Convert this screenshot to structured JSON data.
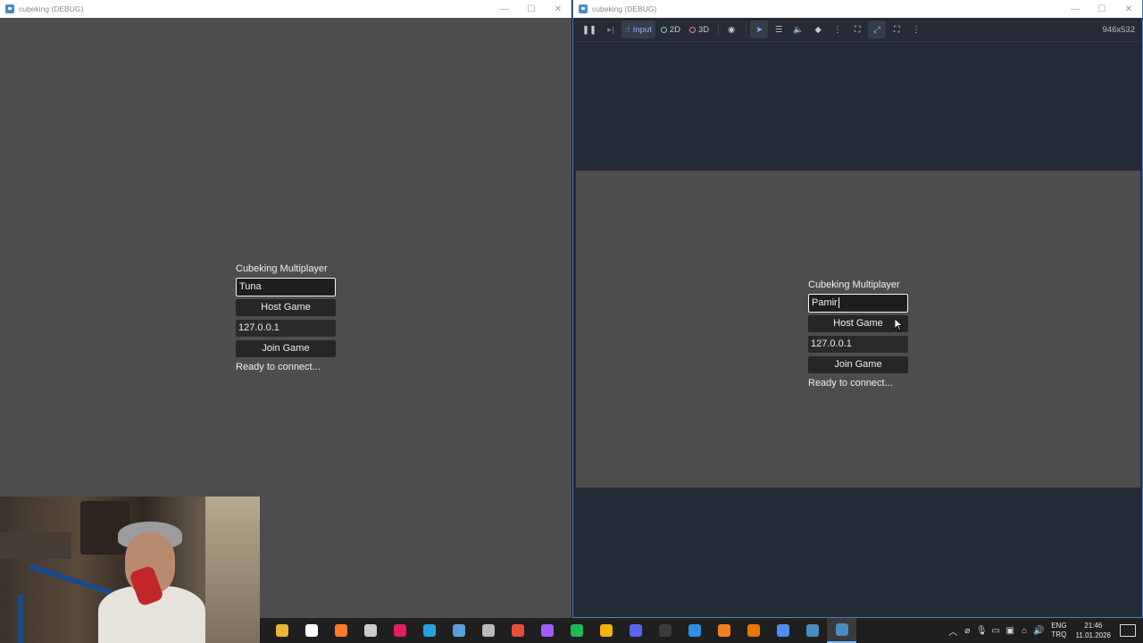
{
  "left_window": {
    "title": "cubeking (DEBUG)",
    "controls": {
      "minimize": "—",
      "maximize": "☐",
      "close": "✕"
    },
    "menu": {
      "title": "Cubeking Multiplayer",
      "name_value": "Tuna",
      "host_label": "Host Game",
      "ip_value": "127.0.0.1",
      "join_label": "Join Game",
      "status": "Ready to connect..."
    }
  },
  "right_window": {
    "title": "cubeking (DEBUG)",
    "controls": {
      "minimize": "—",
      "maximize": "☐",
      "close": "✕"
    },
    "toolbar": {
      "input_label": "Input",
      "mode_2d_label": "2D",
      "mode_3d_label": "3D",
      "size_readout": "946x532"
    },
    "menu": {
      "title": "Cubeking Multiplayer",
      "name_value": "Pamir",
      "host_label": "Host Game",
      "ip_value": "127.0.0.1",
      "join_label": "Join Game",
      "status": "Ready to connect..."
    }
  },
  "taskbar": {
    "apps": [
      {
        "name": "file-explorer-icon",
        "color": "#e8b83a"
      },
      {
        "name": "clock-app-icon",
        "color": "#ffffff"
      },
      {
        "name": "firefox-icon",
        "color": "#ff7a2b"
      },
      {
        "name": "app-ring-icon",
        "color": "#cccccc"
      },
      {
        "name": "slack-icon",
        "color": "#e01e5a"
      },
      {
        "name": "app-blue-icon",
        "color": "#27a2db"
      },
      {
        "name": "steam-icon",
        "color": "#5aa0d8"
      },
      {
        "name": "app-cube-icon",
        "color": "#bbbbbb"
      },
      {
        "name": "app-red-icon",
        "color": "#ea4c3c"
      },
      {
        "name": "figma-icon",
        "color": "#a259ff"
      },
      {
        "name": "spotify-icon",
        "color": "#1db954"
      },
      {
        "name": "chrome-icon",
        "color": "#f4b400"
      },
      {
        "name": "discord-icon",
        "color": "#5865f2"
      },
      {
        "name": "terminal-icon",
        "color": "#3b3b3b"
      },
      {
        "name": "vscode-icon",
        "color": "#2f8ee6"
      },
      {
        "name": "cloudflare-icon",
        "color": "#f38020"
      },
      {
        "name": "blender-icon",
        "color": "#ea7600"
      },
      {
        "name": "app-a-icon",
        "color": "#4f8ef7"
      },
      {
        "name": "godot-icon",
        "color": "#478cbf"
      },
      {
        "name": "godot-debug-icon",
        "color": "#478cbf"
      }
    ],
    "tray": {
      "lang_top": "ENG",
      "lang_bottom": "TRQ",
      "time": "21:46",
      "date": "11.01.2026"
    }
  }
}
